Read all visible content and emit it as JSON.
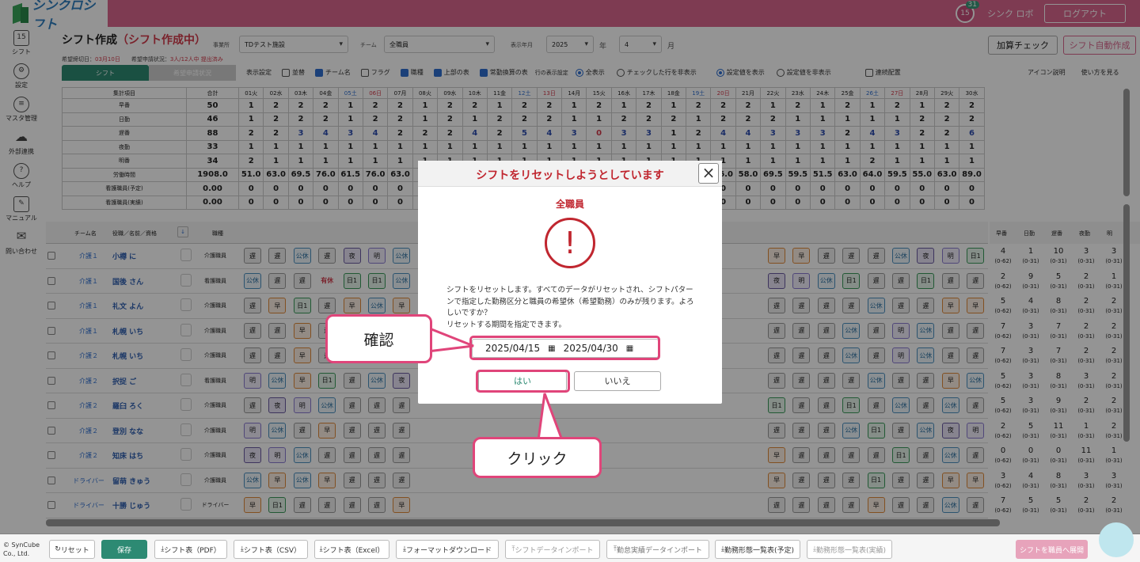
{
  "app": {
    "logo_text": "シンクロシフト",
    "badge_day": "15",
    "badge_count": "31",
    "user": "シンク ロボ",
    "logout": "ログアウト"
  },
  "sidebar": [
    {
      "label": "シフト",
      "icon": "calendar-icon",
      "glyph": "15"
    },
    {
      "label": "設定",
      "icon": "gear-icon",
      "glyph": "⚙"
    },
    {
      "label": "マスタ管理",
      "icon": "database-icon",
      "glyph": "≡"
    },
    {
      "label": "外部連携",
      "icon": "cloud-icon",
      "glyph": "☁"
    },
    {
      "label": "ヘルプ",
      "icon": "help-icon",
      "glyph": "?"
    },
    {
      "label": "マニュアル",
      "icon": "manual-icon",
      "glyph": "✎"
    },
    {
      "label": "問い合わせ",
      "icon": "mail-icon",
      "glyph": "✉"
    }
  ],
  "header": {
    "title": "シフト作成",
    "status": "（シフト作成中）",
    "facility_label": "事業所",
    "facility": "TDテスト施設",
    "team_label": "チーム",
    "team": "全職員",
    "ym_label": "表示年月",
    "year": "2025",
    "year_unit": "年",
    "month": "4",
    "month_unit": "月",
    "check_btn": "加算チェック",
    "auto_btn": "シフト自動作成",
    "deadline_label": "希望締切日：",
    "deadline": "03月10日",
    "apply_label": "希望申請状況：",
    "apply": "3人/12人中 提出済み"
  },
  "tabs": {
    "shift": "シフト",
    "request": "希望申請状況"
  },
  "options": {
    "label": "表示設定",
    "sort": "並替",
    "team_name": "チーム名",
    "flag": "フラグ",
    "job": "職種",
    "upper": "上部の表",
    "fulltime": "常勤換算の表",
    "row_label": "行の表示設定",
    "show_all": "全表示",
    "hide_checked": "チェックした行を非表示",
    "show_setting": "設定値を表示",
    "hide_setting": "設定値を非表示",
    "continuous": "連続配置",
    "icon_help": "アイコン説明",
    "howto": "使い方を見る"
  },
  "stats": {
    "head": [
      "集計項目",
      "合計"
    ],
    "days": [
      "01火",
      "02水",
      "03木",
      "04金",
      "05土",
      "06日",
      "07月",
      "08火",
      "09水",
      "10木",
      "11金",
      "12土",
      "13日",
      "14月",
      "15火",
      "16水",
      "17木",
      "18金",
      "19土",
      "20日",
      "21月",
      "22火",
      "23水",
      "24木",
      "25金",
      "26土",
      "27日",
      "28月",
      "29火",
      "30水"
    ],
    "rows": [
      {
        "label": "早番",
        "total": "50",
        "vals": [
          "1",
          "2",
          "2",
          "2",
          "1",
          "2",
          "2",
          "1",
          "2",
          "2",
          "1",
          "2",
          "2",
          "1",
          "2",
          "1",
          "2",
          "1",
          "2",
          "2",
          "2",
          "1",
          "2",
          "1",
          "2",
          "1",
          "2",
          "1",
          "2",
          "2"
        ]
      },
      {
        "label": "日勤",
        "total": "46",
        "vals": [
          "1",
          "2",
          "2",
          "2",
          "1",
          "2",
          "2",
          "1",
          "2",
          "1",
          "2",
          "2",
          "2",
          "1",
          "1",
          "2",
          "2",
          "2",
          "1",
          "2",
          "2",
          "2",
          "1",
          "1",
          "1",
          "1",
          "1",
          "2",
          "2",
          "2"
        ]
      },
      {
        "label": "遅番",
        "total": "88",
        "vals": [
          "2",
          "2",
          "3",
          "4",
          "3",
          "4",
          "2",
          "2",
          "2",
          "4",
          "2",
          "5",
          "4",
          "3",
          "0",
          "3",
          "3",
          "1",
          "2",
          "4",
          "4",
          "3",
          "3",
          "3",
          "2",
          "4",
          "3",
          "2",
          "2",
          "6"
        ]
      },
      {
        "label": "夜勤",
        "total": "33",
        "vals": [
          "1",
          "1",
          "1",
          "1",
          "1",
          "1",
          "1",
          "1",
          "1",
          "1",
          "1",
          "1",
          "1",
          "1",
          "1",
          "1",
          "1",
          "1",
          "1",
          "1",
          "1",
          "1",
          "1",
          "1",
          "1",
          "1",
          "1",
          "1",
          "1",
          "1"
        ]
      },
      {
        "label": "明番",
        "total": "34",
        "vals": [
          "2",
          "1",
          "1",
          "1",
          "1",
          "1",
          "1",
          "1",
          "1",
          "1",
          "1",
          "1",
          "1",
          "1",
          "1",
          "1",
          "1",
          "1",
          "1",
          "1",
          "1",
          "1",
          "1",
          "1",
          "1",
          "2",
          "1",
          "1",
          "1",
          "1"
        ]
      },
      {
        "label": "労働時間",
        "total": "1908.0",
        "vals": [
          "51.0",
          "63.0",
          "69.5",
          "76.0",
          "61.5",
          "76.0",
          "63.0",
          "",
          "",
          "",
          "",
          "",
          "",
          "",
          "",
          "",
          "",
          "",
          "",
          "66.0",
          "58.0",
          "69.5",
          "59.5",
          "51.5",
          "63.0",
          "64.0",
          "59.5",
          "55.0",
          "63.0",
          "89.0"
        ]
      },
      {
        "label": "看護職員(予定)",
        "total": "0.00",
        "vals": [
          "0",
          "0",
          "0",
          "0",
          "0",
          "0",
          "0",
          "",
          "",
          "",
          "",
          "",
          "",
          "",
          "",
          "",
          "",
          "",
          "",
          "0",
          "0",
          "0",
          "0",
          "0",
          "0",
          "0",
          "0",
          "0",
          "0",
          "0"
        ]
      },
      {
        "label": "看護職員(実績)",
        "total": "0.00",
        "vals": [
          "0",
          "0",
          "0",
          "0",
          "0",
          "0",
          "0",
          "",
          "",
          "",
          "",
          "",
          "",
          "",
          "",
          "",
          "",
          "",
          "",
          "0",
          "0",
          "0",
          "0",
          "0",
          "0",
          "0",
          "0",
          "0",
          "0",
          "0"
        ]
      }
    ]
  },
  "shift_head": {
    "team": "チーム名",
    "name": "役職／名前／資格",
    "job": "職種"
  },
  "staff": [
    {
      "team": "介護１",
      "name": "小樽 に",
      "job": "介護職員",
      "cells": [
        "遅",
        "遅",
        "公休",
        "遅",
        "夜",
        "明",
        "公休"
      ],
      "right": [
        "早",
        "早",
        "遅",
        "遅",
        "遅",
        "公休",
        "夜",
        "明",
        "日1"
      ]
    },
    {
      "team": "介護１",
      "name": "国後 さん",
      "job": "看護職員",
      "cells": [
        "公休",
        "遅",
        "遅",
        "有休",
        "日1",
        "日1",
        "公休"
      ],
      "right": [
        "夜",
        "明",
        "公休",
        "日1",
        "遅",
        "遅",
        "日1",
        "遅",
        "遅"
      ]
    },
    {
      "team": "介護１",
      "name": "礼文 よん",
      "job": "介護職員",
      "cells": [
        "遅",
        "早",
        "日1",
        "遅",
        "早",
        "公休",
        "早"
      ],
      "right": [
        "遅",
        "遅",
        "遅",
        "遅",
        "公休",
        "遅",
        "遅",
        "早",
        "早"
      ]
    },
    {
      "team": "介護１",
      "name": "札幌 いち",
      "job": "介護職員",
      "cells": [
        "遅",
        "遅",
        "早",
        "遅",
        "遅",
        "公休",
        "早"
      ],
      "right": [
        "遅",
        "遅",
        "遅",
        "公休",
        "遅",
        "明",
        "公休",
        "遅",
        "遅"
      ]
    },
    {
      "team": "介護２",
      "name": "札幌 いち",
      "job": "介護職員",
      "cells": [
        "遅",
        "遅",
        "早",
        "遅",
        "遅",
        "公休",
        "早"
      ],
      "right": [
        "遅",
        "遅",
        "遅",
        "公休",
        "遅",
        "明",
        "公休",
        "遅",
        "遅"
      ]
    },
    {
      "team": "介護２",
      "name": "択捉 ご",
      "job": "看護職員",
      "cells": [
        "明",
        "公休",
        "早",
        "日1",
        "遅",
        "公休",
        "夜"
      ],
      "right": [
        "遅",
        "遅",
        "遅",
        "遅",
        "公休",
        "遅",
        "遅",
        "早",
        "公休"
      ]
    },
    {
      "team": "介護２",
      "name": "羅臼 ろく",
      "job": "介護職員",
      "cells": [
        "遅",
        "夜",
        "明",
        "公休",
        "遅",
        "遅",
        "遅"
      ],
      "right": [
        "日1",
        "遅",
        "遅",
        "日1",
        "遅",
        "公休",
        "遅",
        "公休",
        "遅"
      ]
    },
    {
      "team": "介護２",
      "name": "登別 なな",
      "job": "介護職員",
      "cells": [
        "明",
        "公休",
        "遅",
        "早",
        "遅",
        "遅",
        "遅"
      ],
      "right": [
        "遅",
        "遅",
        "遅",
        "公休",
        "日1",
        "遅",
        "公休",
        "夜",
        "明"
      ]
    },
    {
      "team": "介護２",
      "name": "知床 はち",
      "job": "介護職員",
      "cells": [
        "夜",
        "明",
        "公休",
        "遅",
        "遅",
        "遅",
        "遅"
      ],
      "right": [
        "早",
        "遅",
        "遅",
        "遅",
        "遅",
        "日1",
        "遅",
        "公休",
        "遅"
      ]
    },
    {
      "team": "ドライバー",
      "name": "留萌 きゅう",
      "job": "介護職員",
      "cells": [
        "公休",
        "早",
        "公休",
        "早",
        "遅",
        "遅",
        "遅"
      ],
      "right": [
        "早",
        "遅",
        "遅",
        "遅",
        "日1",
        "遅",
        "遅",
        "早",
        "早"
      ]
    },
    {
      "team": "ドライバー",
      "name": "十勝 じゅう",
      "job": "ドライバー",
      "cells": [
        "早",
        "日1",
        "遅",
        "遅",
        "遅",
        "遅",
        "早"
      ],
      "right": [
        "遅",
        "遅",
        "遅",
        "遅",
        "早",
        "遅",
        "遅",
        "公休",
        "遅"
      ]
    }
  ],
  "right_summary": {
    "head": [
      "早番",
      "日勤",
      "遅番",
      "夜勤",
      "明"
    ],
    "rows": [
      [
        "4",
        "1",
        "10",
        "3",
        "3"
      ],
      [
        "2",
        "9",
        "5",
        "2",
        "1"
      ],
      [
        "5",
        "4",
        "8",
        "2",
        "2"
      ],
      [
        "7",
        "3",
        "7",
        "2",
        "2"
      ],
      [
        "7",
        "3",
        "7",
        "2",
        "2"
      ],
      [
        "5",
        "3",
        "8",
        "3",
        "2"
      ],
      [
        "5",
        "3",
        "9",
        "2",
        "2"
      ],
      [
        "2",
        "5",
        "11",
        "1",
        "2"
      ],
      [
        "0",
        "0",
        "0",
        "11",
        "1"
      ],
      [
        "3",
        "4",
        "8",
        "3",
        "3"
      ],
      [
        "7",
        "5",
        "5",
        "2",
        "2"
      ]
    ],
    "ranges": [
      "(0-62)",
      "(0-31)",
      "(0-31)",
      "(0-31)",
      "(0-31)"
    ]
  },
  "modal": {
    "title": "シフトをリセットしようとしています",
    "close": "×",
    "subtitle": "全職員",
    "warn": "!",
    "message": "シフトをリセットします。すべてのデータがリセットされ、シフトパターンで指定した勤務区分と職員の希望休（希望勤務）のみが残ります。よろしいですか？\nリセットする期間を指定できます。",
    "date_from": "2025/04/15",
    "date_to": "2025/04/30",
    "yes": "はい",
    "no": "いいえ"
  },
  "callouts": {
    "confirm": "確認",
    "click": "クリック"
  },
  "footer": {
    "copyright": "© SynCube Co., Ltd.",
    "reset": "リセット",
    "save": "保存",
    "pdf": "シフト表（PDF）",
    "csv": "シフト表（CSV）",
    "excel": "シフト表（Excel）",
    "format": "フォーマットダウンロード",
    "import": "シフトデータインポート",
    "attendance": "勤怠実績データインポート",
    "plan_list": "勤務形態一覧表(予定)",
    "actual_list": "勤務形態一覧表(実績)",
    "publish": "シフトを職員へ展開"
  },
  "colors": {
    "brand": "#d9668e",
    "accent": "#2d8a73",
    "alert": "#c0262f",
    "highlight": "#e0457a"
  }
}
